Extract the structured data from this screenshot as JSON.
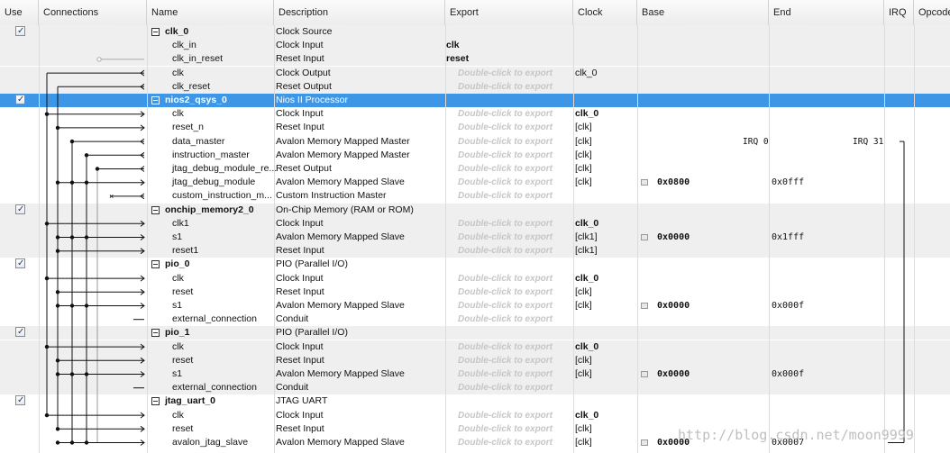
{
  "columns": [
    "Use",
    "Connections",
    "Name",
    "Description",
    "Export",
    "Clock",
    "Base",
    "End",
    "IRQ",
    "Opcode"
  ],
  "export_placeholder": "Double-click to export",
  "rows": [
    {
      "kind": "component",
      "name": "clk_0",
      "desc": "Clock Source",
      "use": true
    },
    {
      "kind": "port",
      "name": "clk_in",
      "desc": "Clock Input",
      "export": "clk"
    },
    {
      "kind": "port",
      "name": "clk_in_reset",
      "desc": "Reset Input",
      "export": "reset"
    },
    {
      "kind": "port",
      "name": "clk",
      "desc": "Clock Output",
      "clock": "clk_0"
    },
    {
      "kind": "port",
      "name": "clk_reset",
      "desc": "Reset Output"
    },
    {
      "kind": "component",
      "name": "nios2_qsys_0",
      "desc": "Nios II Processor",
      "use": true,
      "selected": true
    },
    {
      "kind": "port",
      "name": "clk",
      "desc": "Clock Input",
      "clock": "clk_0",
      "clock_bold": true
    },
    {
      "kind": "port",
      "name": "reset_n",
      "desc": "Reset Input",
      "clock": "[clk]"
    },
    {
      "kind": "port",
      "name": "data_master",
      "desc": "Avalon Memory Mapped Master",
      "clock": "[clk]",
      "irq_start": "IRQ 0",
      "irq_end": "IRQ 31"
    },
    {
      "kind": "port",
      "name": "instruction_master",
      "desc": "Avalon Memory Mapped Master",
      "clock": "[clk]"
    },
    {
      "kind": "port",
      "name": "jtag_debug_module_re...",
      "desc": "Reset Output",
      "clock": "[clk]"
    },
    {
      "kind": "port",
      "name": "jtag_debug_module",
      "desc": "Avalon Memory Mapped Slave",
      "clock": "[clk]",
      "base": "0x0800",
      "end": "0x0fff"
    },
    {
      "kind": "port",
      "name": "custom_instruction_m...",
      "desc": "Custom Instruction Master"
    },
    {
      "kind": "component",
      "name": "onchip_memory2_0",
      "desc": "On-Chip Memory (RAM or ROM)",
      "use": true
    },
    {
      "kind": "port",
      "name": "clk1",
      "desc": "Clock Input",
      "clock": "clk_0",
      "clock_bold": true
    },
    {
      "kind": "port",
      "name": "s1",
      "desc": "Avalon Memory Mapped Slave",
      "clock": "[clk1]",
      "base": "0x0000",
      "end": "0x1fff"
    },
    {
      "kind": "port",
      "name": "reset1",
      "desc": "Reset Input",
      "clock": "[clk1]"
    },
    {
      "kind": "component",
      "name": "pio_0",
      "desc": "PIO (Parallel I/O)",
      "use": true
    },
    {
      "kind": "port",
      "name": "clk",
      "desc": "Clock Input",
      "clock": "clk_0",
      "clock_bold": true
    },
    {
      "kind": "port",
      "name": "reset",
      "desc": "Reset Input",
      "clock": "[clk]"
    },
    {
      "kind": "port",
      "name": "s1",
      "desc": "Avalon Memory Mapped Slave",
      "clock": "[clk]",
      "base": "0x0000",
      "end": "0x000f"
    },
    {
      "kind": "port",
      "name": "external_connection",
      "desc": "Conduit"
    },
    {
      "kind": "component",
      "name": "pio_1",
      "desc": "PIO (Parallel I/O)",
      "use": true
    },
    {
      "kind": "port",
      "name": "clk",
      "desc": "Clock Input",
      "clock": "clk_0",
      "clock_bold": true
    },
    {
      "kind": "port",
      "name": "reset",
      "desc": "Reset Input",
      "clock": "[clk]"
    },
    {
      "kind": "port",
      "name": "s1",
      "desc": "Avalon Memory Mapped Slave",
      "clock": "[clk]",
      "base": "0x0000",
      "end": "0x000f"
    },
    {
      "kind": "port",
      "name": "external_connection",
      "desc": "Conduit"
    },
    {
      "kind": "component",
      "name": "jtag_uart_0",
      "desc": "JTAG UART",
      "use": true
    },
    {
      "kind": "port",
      "name": "clk",
      "desc": "Clock Input",
      "clock": "clk_0",
      "clock_bold": true
    },
    {
      "kind": "port",
      "name": "reset",
      "desc": "Reset Input",
      "clock": "[clk]"
    },
    {
      "kind": "port",
      "name": "avalon_jtag_slave",
      "desc": "Avalon Memory Mapped Slave",
      "clock": "[clk]",
      "base": "0x0000",
      "end": "0x0007"
    }
  ],
  "watermark": "http://blog.csdn.net/moon9999"
}
